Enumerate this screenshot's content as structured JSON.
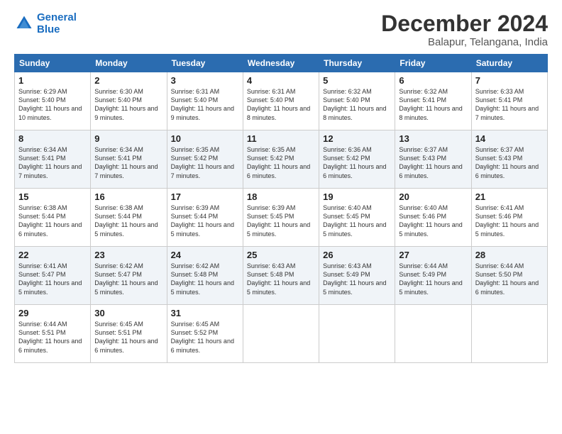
{
  "logo": {
    "line1": "General",
    "line2": "Blue"
  },
  "title": "December 2024",
  "location": "Balapur, Telangana, India",
  "days_of_week": [
    "Sunday",
    "Monday",
    "Tuesday",
    "Wednesday",
    "Thursday",
    "Friday",
    "Saturday"
  ],
  "weeks": [
    [
      {
        "day": "1",
        "sunrise": "Sunrise: 6:29 AM",
        "sunset": "Sunset: 5:40 PM",
        "daylight": "Daylight: 11 hours and 10 minutes."
      },
      {
        "day": "2",
        "sunrise": "Sunrise: 6:30 AM",
        "sunset": "Sunset: 5:40 PM",
        "daylight": "Daylight: 11 hours and 9 minutes."
      },
      {
        "day": "3",
        "sunrise": "Sunrise: 6:31 AM",
        "sunset": "Sunset: 5:40 PM",
        "daylight": "Daylight: 11 hours and 9 minutes."
      },
      {
        "day": "4",
        "sunrise": "Sunrise: 6:31 AM",
        "sunset": "Sunset: 5:40 PM",
        "daylight": "Daylight: 11 hours and 8 minutes."
      },
      {
        "day": "5",
        "sunrise": "Sunrise: 6:32 AM",
        "sunset": "Sunset: 5:40 PM",
        "daylight": "Daylight: 11 hours and 8 minutes."
      },
      {
        "day": "6",
        "sunrise": "Sunrise: 6:32 AM",
        "sunset": "Sunset: 5:41 PM",
        "daylight": "Daylight: 11 hours and 8 minutes."
      },
      {
        "day": "7",
        "sunrise": "Sunrise: 6:33 AM",
        "sunset": "Sunset: 5:41 PM",
        "daylight": "Daylight: 11 hours and 7 minutes."
      }
    ],
    [
      {
        "day": "8",
        "sunrise": "Sunrise: 6:34 AM",
        "sunset": "Sunset: 5:41 PM",
        "daylight": "Daylight: 11 hours and 7 minutes."
      },
      {
        "day": "9",
        "sunrise": "Sunrise: 6:34 AM",
        "sunset": "Sunset: 5:41 PM",
        "daylight": "Daylight: 11 hours and 7 minutes."
      },
      {
        "day": "10",
        "sunrise": "Sunrise: 6:35 AM",
        "sunset": "Sunset: 5:42 PM",
        "daylight": "Daylight: 11 hours and 7 minutes."
      },
      {
        "day": "11",
        "sunrise": "Sunrise: 6:35 AM",
        "sunset": "Sunset: 5:42 PM",
        "daylight": "Daylight: 11 hours and 6 minutes."
      },
      {
        "day": "12",
        "sunrise": "Sunrise: 6:36 AM",
        "sunset": "Sunset: 5:42 PM",
        "daylight": "Daylight: 11 hours and 6 minutes."
      },
      {
        "day": "13",
        "sunrise": "Sunrise: 6:37 AM",
        "sunset": "Sunset: 5:43 PM",
        "daylight": "Daylight: 11 hours and 6 minutes."
      },
      {
        "day": "14",
        "sunrise": "Sunrise: 6:37 AM",
        "sunset": "Sunset: 5:43 PM",
        "daylight": "Daylight: 11 hours and 6 minutes."
      }
    ],
    [
      {
        "day": "15",
        "sunrise": "Sunrise: 6:38 AM",
        "sunset": "Sunset: 5:44 PM",
        "daylight": "Daylight: 11 hours and 6 minutes."
      },
      {
        "day": "16",
        "sunrise": "Sunrise: 6:38 AM",
        "sunset": "Sunset: 5:44 PM",
        "daylight": "Daylight: 11 hours and 5 minutes."
      },
      {
        "day": "17",
        "sunrise": "Sunrise: 6:39 AM",
        "sunset": "Sunset: 5:44 PM",
        "daylight": "Daylight: 11 hours and 5 minutes."
      },
      {
        "day": "18",
        "sunrise": "Sunrise: 6:39 AM",
        "sunset": "Sunset: 5:45 PM",
        "daylight": "Daylight: 11 hours and 5 minutes."
      },
      {
        "day": "19",
        "sunrise": "Sunrise: 6:40 AM",
        "sunset": "Sunset: 5:45 PM",
        "daylight": "Daylight: 11 hours and 5 minutes."
      },
      {
        "day": "20",
        "sunrise": "Sunrise: 6:40 AM",
        "sunset": "Sunset: 5:46 PM",
        "daylight": "Daylight: 11 hours and 5 minutes."
      },
      {
        "day": "21",
        "sunrise": "Sunrise: 6:41 AM",
        "sunset": "Sunset: 5:46 PM",
        "daylight": "Daylight: 11 hours and 5 minutes."
      }
    ],
    [
      {
        "day": "22",
        "sunrise": "Sunrise: 6:41 AM",
        "sunset": "Sunset: 5:47 PM",
        "daylight": "Daylight: 11 hours and 5 minutes."
      },
      {
        "day": "23",
        "sunrise": "Sunrise: 6:42 AM",
        "sunset": "Sunset: 5:47 PM",
        "daylight": "Daylight: 11 hours and 5 minutes."
      },
      {
        "day": "24",
        "sunrise": "Sunrise: 6:42 AM",
        "sunset": "Sunset: 5:48 PM",
        "daylight": "Daylight: 11 hours and 5 minutes."
      },
      {
        "day": "25",
        "sunrise": "Sunrise: 6:43 AM",
        "sunset": "Sunset: 5:48 PM",
        "daylight": "Daylight: 11 hours and 5 minutes."
      },
      {
        "day": "26",
        "sunrise": "Sunrise: 6:43 AM",
        "sunset": "Sunset: 5:49 PM",
        "daylight": "Daylight: 11 hours and 5 minutes."
      },
      {
        "day": "27",
        "sunrise": "Sunrise: 6:44 AM",
        "sunset": "Sunset: 5:49 PM",
        "daylight": "Daylight: 11 hours and 5 minutes."
      },
      {
        "day": "28",
        "sunrise": "Sunrise: 6:44 AM",
        "sunset": "Sunset: 5:50 PM",
        "daylight": "Daylight: 11 hours and 6 minutes."
      }
    ],
    [
      {
        "day": "29",
        "sunrise": "Sunrise: 6:44 AM",
        "sunset": "Sunset: 5:51 PM",
        "daylight": "Daylight: 11 hours and 6 minutes."
      },
      {
        "day": "30",
        "sunrise": "Sunrise: 6:45 AM",
        "sunset": "Sunset: 5:51 PM",
        "daylight": "Daylight: 11 hours and 6 minutes."
      },
      {
        "day": "31",
        "sunrise": "Sunrise: 6:45 AM",
        "sunset": "Sunset: 5:52 PM",
        "daylight": "Daylight: 11 hours and 6 minutes."
      },
      null,
      null,
      null,
      null
    ]
  ]
}
